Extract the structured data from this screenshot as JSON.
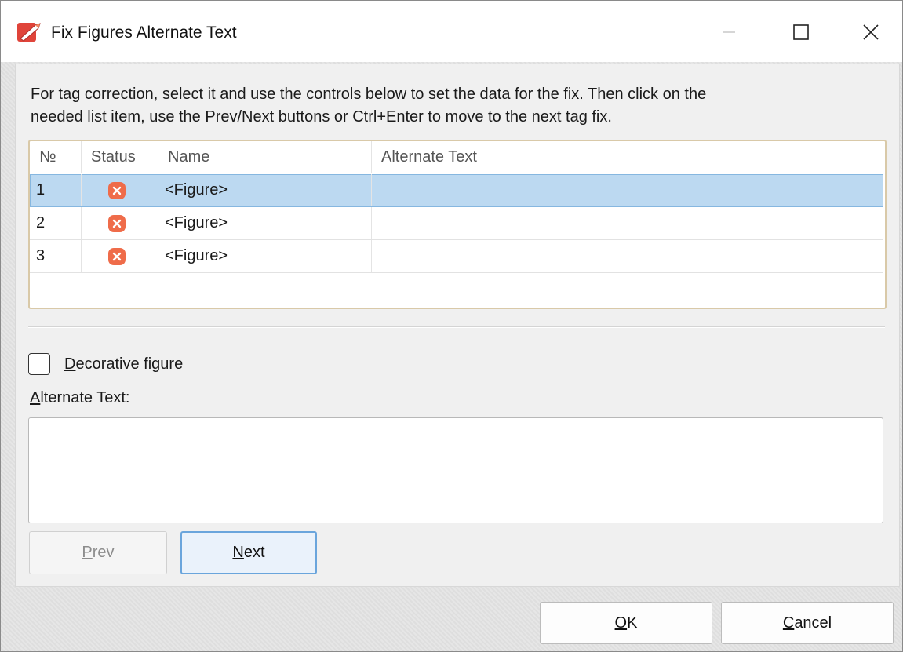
{
  "window": {
    "title": "Fix Figures Alternate Text"
  },
  "instructions": {
    "line1": "For tag correction, select it and use the controls below to set the data for the fix. Then click on the",
    "line2": "needed list item, use the Prev/Next buttons or Ctrl+Enter to move to the next tag fix."
  },
  "table": {
    "columns": [
      "№",
      "Status",
      "Name",
      "Alternate Text"
    ],
    "rows": [
      {
        "no": "1",
        "status": "error-icon",
        "name": "<Figure>",
        "alt": "",
        "selected": true
      },
      {
        "no": "2",
        "status": "error-icon",
        "name": "<Figure>",
        "alt": "",
        "selected": false
      },
      {
        "no": "3",
        "status": "error-icon",
        "name": "<Figure>",
        "alt": "",
        "selected": false
      }
    ]
  },
  "decorative": {
    "mnemonic": "D",
    "rest": "ecorative figure",
    "checked": false
  },
  "alt_text": {
    "mnemonic": "A",
    "rest": "lternate Text:",
    "value": ""
  },
  "nav": {
    "prev_mnemonic": "P",
    "prev_rest": "rev",
    "prev_enabled": false,
    "next_mnemonic": "N",
    "next_rest": "ext"
  },
  "footer": {
    "ok_mnemonic": "O",
    "ok_rest": "K",
    "cancel_mnemonic": "C",
    "cancel_rest": "ancel"
  },
  "colors": {
    "selection": "#bcd9f1",
    "error": "#ef6c4a",
    "accent_border": "#6aa5dc"
  }
}
